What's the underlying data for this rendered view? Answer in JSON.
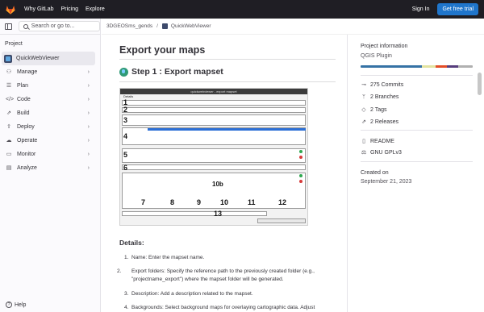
{
  "topnav": {
    "links": [
      "Why GitLab",
      "Pricing",
      "Explore"
    ],
    "sign_in": "Sign In",
    "free_trial": "Get free trial"
  },
  "sidebar": {
    "search_placeholder": "Search or go to...",
    "section": "Project",
    "project_name": "QuickWebViewer",
    "items": [
      {
        "label": "Manage",
        "icon": "users-icon"
      },
      {
        "label": "Plan",
        "icon": "plan-icon"
      },
      {
        "label": "Code",
        "icon": "code-icon"
      },
      {
        "label": "Build",
        "icon": "rocket-icon"
      },
      {
        "label": "Deploy",
        "icon": "deploy-icon"
      },
      {
        "label": "Operate",
        "icon": "cloud-icon"
      },
      {
        "label": "Monitor",
        "icon": "monitor-icon"
      },
      {
        "label": "Analyze",
        "icon": "chart-icon"
      }
    ],
    "help": "Help"
  },
  "breadcrumb": {
    "group": "3DGEOSms_gends",
    "project": "QuickWebViewer"
  },
  "content": {
    "title": "Export your maps",
    "step_title": "Step 1 : Export mapset",
    "embedded_screenshot": {
      "window_title": "quickwebviewer - export mapset",
      "tab": "Details",
      "numbers": [
        "1",
        "2",
        "3",
        "4",
        "5",
        "6",
        "10b",
        "7",
        "8",
        "9",
        "10",
        "11",
        "12",
        "13"
      ]
    },
    "details_heading": "Details:",
    "list": [
      "Name: Enter the mapset name.",
      "Export folders: Specify the reference path to the previously created folder (e.g., \"projectname_export\") where the mapset folder will be generated.",
      "Description: Add a description related to the mapset.",
      "Backgrounds: Select background maps for overlaying cartographic data. Adjust"
    ]
  },
  "project_info": {
    "heading": "Project information",
    "description": "QGIS Plugin",
    "language_colors": [
      "#3572A5",
      "#e3e3a0",
      "#e34c26",
      "#563d7c",
      "#b0b0b0"
    ],
    "language_shares": [
      0.55,
      0.12,
      0.1,
      0.1,
      0.13
    ],
    "stats": [
      {
        "label": "275 Commits",
        "icon": "commit-icon"
      },
      {
        "label": "2 Branches",
        "icon": "branch-icon"
      },
      {
        "label": "2 Tags",
        "icon": "tag-icon"
      },
      {
        "label": "2 Releases",
        "icon": "rocket-icon"
      }
    ],
    "links": [
      {
        "label": "README",
        "icon": "book-icon"
      },
      {
        "label": "GNU GPLv3",
        "icon": "scale-icon"
      }
    ],
    "created_heading": "Created on",
    "created_date": "September 21, 2023"
  }
}
